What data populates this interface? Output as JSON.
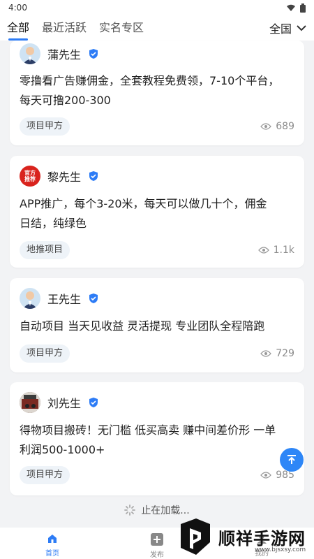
{
  "status": {
    "time": "4:00"
  },
  "tabs": [
    {
      "label": "全部",
      "active": true
    },
    {
      "label": "最近活跃",
      "active": false
    },
    {
      "label": "实名专区",
      "active": false
    }
  ],
  "region": {
    "label": "全国"
  },
  "posts": [
    {
      "name": "蒲先生",
      "avatar": "person-avatar",
      "content_line1": "零撸看广告赚佣金，全套教程免费领，7-10个平台，",
      "content_line2": "每天可撸200-300",
      "tag": "项目甲方",
      "views": "689"
    },
    {
      "name": "黎先生",
      "avatar": "official-badge-avatar",
      "badge_line1": "官方",
      "badge_line2": "推荐",
      "content_line1": "APP推广，每个3-20米，每天可以做几十个，佣金",
      "content_line2": "日结，纯绿色",
      "tag": "地推项目",
      "views": "1.1k"
    },
    {
      "name": "王先生",
      "avatar": "person-avatar",
      "content_line1": "自动项目 当天见收益 灵活提现 专业团队全程陪跑",
      "tag": "项目甲方",
      "views": "729"
    },
    {
      "name": "刘先生",
      "avatar": "photo-avatar",
      "content_line1": "得物项目搬砖！无门槛 低买高卖 赚中间差价形 一单",
      "content_line2": "利润500-1000+",
      "tag": "项目甲方",
      "views": "985"
    }
  ],
  "loading_text": "止在加载...",
  "nav": [
    {
      "label": "首页",
      "icon": "home-icon",
      "active": true
    },
    {
      "label": "发布",
      "icon": "plus-icon",
      "active": false
    },
    {
      "label": "我的",
      "icon": "user-icon",
      "active": false
    }
  ],
  "watermark": {
    "text": "顺祥手游网",
    "url": "www.bjsxsy.com"
  },
  "colors": {
    "accent": "#2d7cf6",
    "background": "#f2f3f5",
    "tag_bg": "#eef3f8",
    "official_red": "#d9231d"
  }
}
